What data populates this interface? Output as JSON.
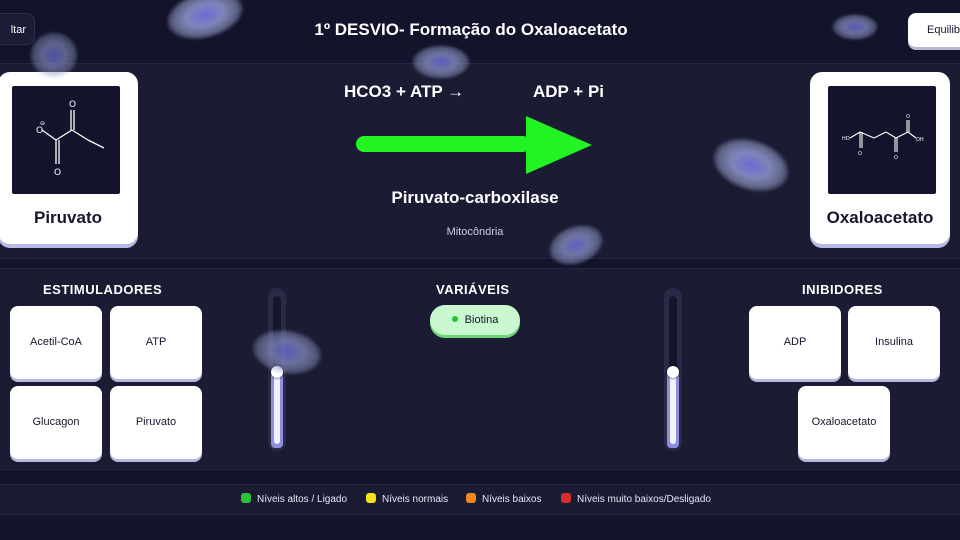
{
  "header": {
    "back_label": "ltar",
    "title": "1º DESVIO- Formação do Oxaloacetato",
    "equilibrium_label": "Equilib"
  },
  "reaction": {
    "substrate": "Piruvato",
    "product": "Oxaloacetato",
    "inputs": "HCO3 + ATP →",
    "outputs": "ADP + Pi",
    "enzyme": "Piruvato-carboxilase",
    "location": "Mitocôndria",
    "arrow_color": "#22f322"
  },
  "regulation": {
    "stimulators_title": "ESTIMULADORES",
    "stimulators": [
      "Acetil-CoA",
      "ATP",
      "Glucagon",
      "Piruvato"
    ],
    "variables_title": "VARIÁVEIS",
    "variable_chip": "Biotina",
    "inhibitors_title": "INIBIDORES",
    "inhibitors": [
      "ADP",
      "Insulina",
      "Oxaloacetato"
    ],
    "slider_left_level": 0.5,
    "slider_right_level": 0.5
  },
  "legend": [
    {
      "label": "Níveis altos / Ligado",
      "color": "#2bc13a"
    },
    {
      "label": "Níveis normais",
      "color": "#f1e51a"
    },
    {
      "label": "Níveis baixos",
      "color": "#f08a1c"
    },
    {
      "label": "Níveis muito baixos/Desligado",
      "color": "#d92c2c"
    }
  ],
  "colors": {
    "background": "#13132b",
    "panel": "#1b1b34",
    "card": "#ffffff",
    "slider_fill": "#8d8fde",
    "chip_bg": "#c9f7cf"
  }
}
